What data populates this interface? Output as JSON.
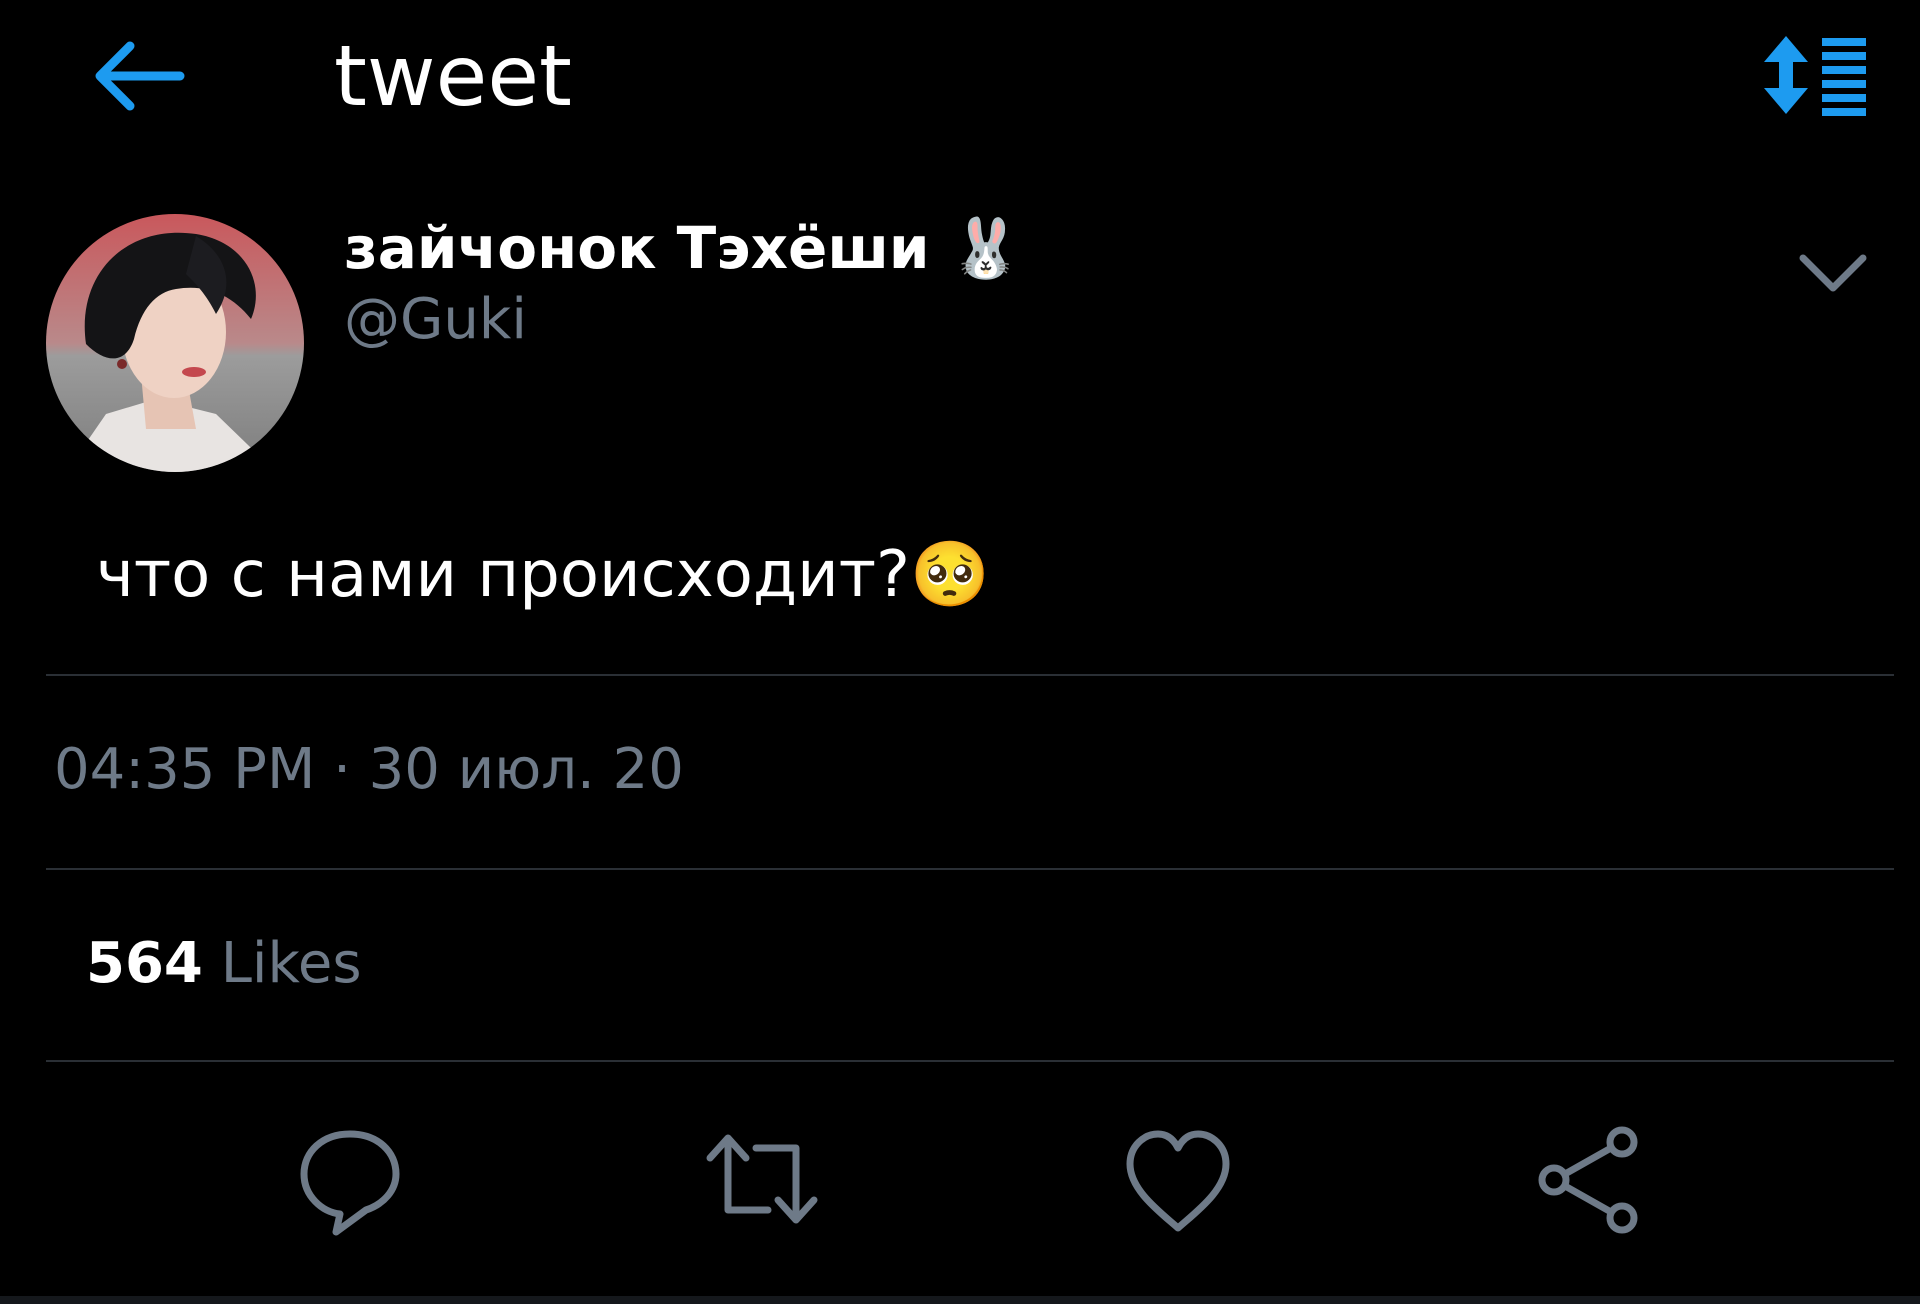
{
  "header": {
    "title": "tweet",
    "back_icon": "arrow-left-icon",
    "sort_icon": "sort-list-icon",
    "accent_color": "#1d9bf0"
  },
  "author": {
    "display_name": "зайчонок Тэхёши 🐰",
    "handle": "@Guki",
    "avatar": "profile-photo"
  },
  "tweet": {
    "text": "что с нами происходит?🥺",
    "timestamp": "04:35 PM · 30 июл. 20"
  },
  "stats": {
    "likes_count": "564",
    "likes_label": "Likes"
  },
  "actions": [
    {
      "icon": "reply-icon"
    },
    {
      "icon": "retweet-icon"
    },
    {
      "icon": "like-icon"
    },
    {
      "icon": "share-icon"
    }
  ],
  "colors": {
    "background": "#000000",
    "text": "#ffffff",
    "secondary_text": "#6e7a88",
    "divider": "#2a2f35",
    "icon": "#6e7a88"
  }
}
